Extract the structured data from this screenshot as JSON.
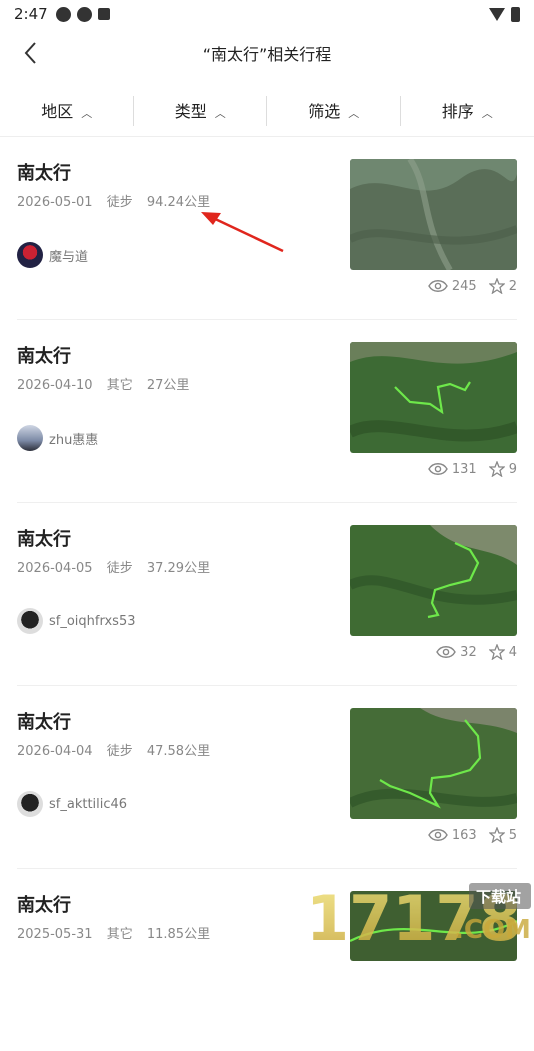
{
  "status": {
    "time": "2:47"
  },
  "header": {
    "title": "“南太行”相关行程"
  },
  "filters": [
    {
      "label": "地区"
    },
    {
      "label": "类型"
    },
    {
      "label": "筛选"
    },
    {
      "label": "排序"
    }
  ],
  "trips": [
    {
      "title": "南太行",
      "date": "2026-05-01",
      "type": "徒步",
      "distance": "94.24公里",
      "user": "魔与道",
      "views": "245",
      "stars": "2"
    },
    {
      "title": "南太行",
      "date": "2026-04-10",
      "type": "其它",
      "distance": "27公里",
      "user": "zhu惠惠",
      "views": "131",
      "stars": "9"
    },
    {
      "title": "南太行",
      "date": "2026-04-05",
      "type": "徒步",
      "distance": "37.29公里",
      "user": "sf_oiqhfrxs53",
      "views": "32",
      "stars": "4"
    },
    {
      "title": "南太行",
      "date": "2026-04-04",
      "type": "徒步",
      "distance": "47.58公里",
      "user": "sf_akttilic46",
      "views": "163",
      "stars": "5"
    },
    {
      "title": "南太行",
      "date": "2025-05-31",
      "type": "其它",
      "distance": "11.85公里"
    }
  ],
  "watermark": {
    "brand": "17178",
    "caption": "下载站",
    "domain": ".COM"
  }
}
